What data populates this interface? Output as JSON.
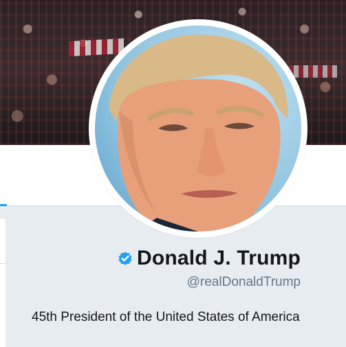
{
  "profile": {
    "display_name": "Donald J. Trump",
    "handle": "@realDonaldTrump",
    "bio": "45th President of the United States of America",
    "verified": true
  },
  "icons": {
    "verified": "verified-badge-icon"
  },
  "colors": {
    "accent": "#1da1f2",
    "name": "#14171a",
    "handle": "#657786",
    "background": "#e6ecf0"
  }
}
